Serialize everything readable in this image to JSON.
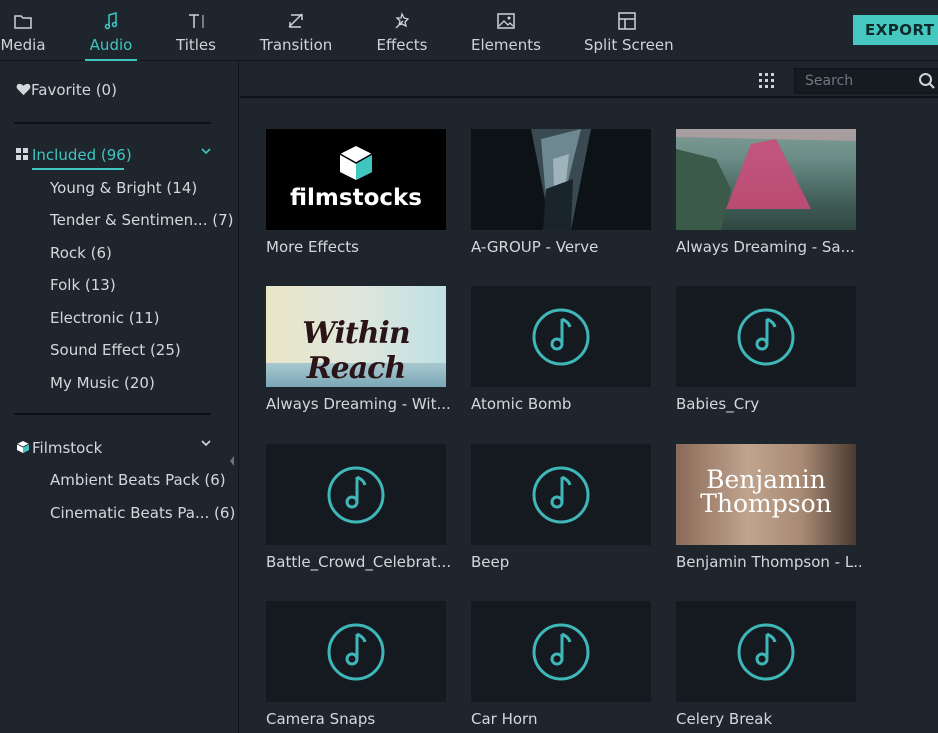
{
  "toolbar": {
    "tabs": [
      {
        "label": "Media"
      },
      {
        "label": "Audio"
      },
      {
        "label": "Titles"
      },
      {
        "label": "Transition"
      },
      {
        "label": "Effects"
      },
      {
        "label": "Elements"
      },
      {
        "label": "Split Screen"
      }
    ],
    "active_tab": "Audio",
    "export_label": "EXPORT"
  },
  "sidebar": {
    "favorite": "Favorite (0)",
    "included": "Included (96)",
    "included_items": [
      "Young & Bright (14)",
      "Tender & Sentimen... (7)",
      "Rock (6)",
      "Folk (13)",
      "Electronic (11)",
      "Sound Effect (25)",
      "My Music (20)"
    ],
    "filmstock": "Filmstock",
    "filmstock_items": [
      "Ambient Beats Pack (6)",
      "Cinematic Beats Pa... (6)"
    ]
  },
  "search": {
    "placeholder": "Search"
  },
  "colors": {
    "accent": "#3fc6c0",
    "background": "#1f252d",
    "export_bg": "#46c8c1"
  },
  "thumb_texts": {
    "filmstocks_logo": "filmstocks",
    "within_reach": "Within Reach",
    "benjamin_line1": "Benjamin",
    "benjamin_line2": "Thompson"
  },
  "items": [
    {
      "label": "More Effects",
      "thumb": "filmstocks"
    },
    {
      "label": "A-GROUP - Verve",
      "thumb": "agroup"
    },
    {
      "label": "Always Dreaming - Sa...",
      "thumb": "coast"
    },
    {
      "label": "Always Dreaming - Wit...",
      "thumb": "withinreach"
    },
    {
      "label": "Atomic Bomb",
      "thumb": "music-note"
    },
    {
      "label": "Babies_Cry",
      "thumb": "music-note"
    },
    {
      "label": "Battle_Crowd_Celebrat...",
      "thumb": "music-note"
    },
    {
      "label": "Beep",
      "thumb": "music-note"
    },
    {
      "label": "Benjamin Thompson - L...",
      "thumb": "benjamin"
    },
    {
      "label": "Camera Snaps",
      "thumb": "music-note"
    },
    {
      "label": "Car Horn",
      "thumb": "music-note"
    },
    {
      "label": "Celery Break",
      "thumb": "music-note"
    }
  ]
}
